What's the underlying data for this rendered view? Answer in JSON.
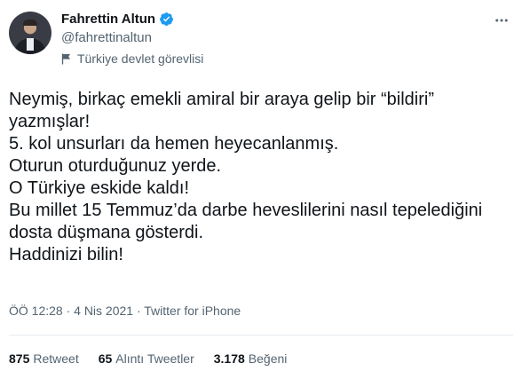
{
  "author": {
    "display_name": "Fahrettin Altun",
    "handle": "@fahrettinaltun",
    "account_label": "Türkiye devlet görevlisi",
    "verified_color": "#1d9bf0"
  },
  "tweet": {
    "text": "Neymiş, birkaç emekli amiral bir araya gelip bir “bildiri” yazmışlar!\n5. kol unsurları da hemen heyecanlanmış.\nOturun oturduğunuz yerde.\nO Türkiye eskide kaldı!\nBu millet 15 Temmuz’da darbe heveslilerini nasıl tepelediğini dosta düşmana gösterdi.\nHaddinizi bilin!",
    "meta": "ÖÖ 12:28 · 4 Nis 2021 · Twitter for iPhone"
  },
  "stats": {
    "retweets_count": "875",
    "retweets_label": "Retweet",
    "quotes_count": "65",
    "quotes_label": "Alıntı Tweetler",
    "likes_count": "3.178",
    "likes_label": "Beğeni"
  },
  "icons": {
    "verified": "verified-badge-icon",
    "label": "flag-icon",
    "more": "more-options-icon"
  }
}
